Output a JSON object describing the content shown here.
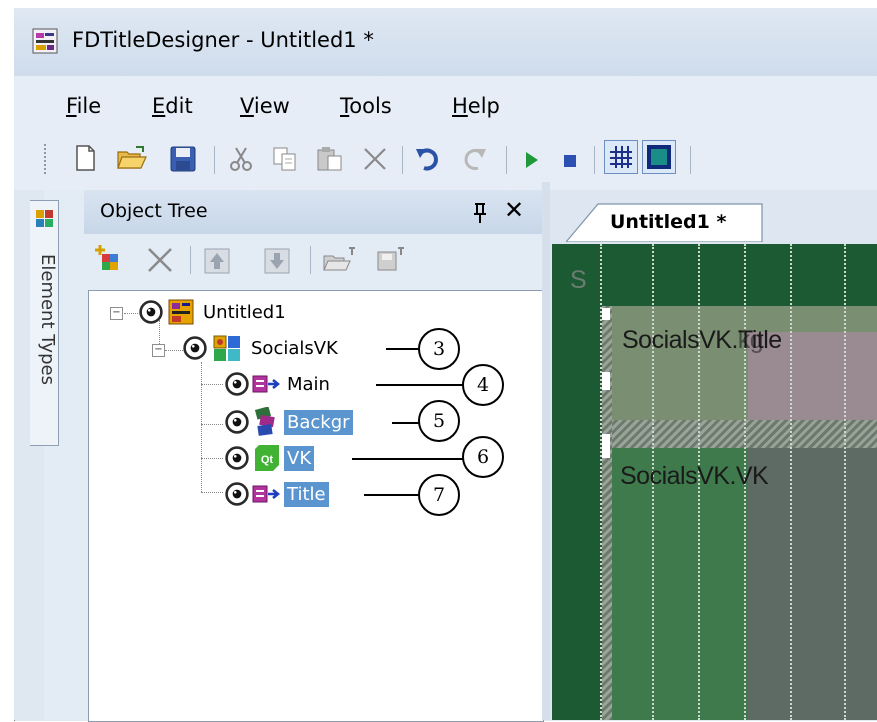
{
  "window": {
    "title": "FDTitleDesigner - Untitled1 *"
  },
  "menu": [
    {
      "first": "F",
      "rest": "ile"
    },
    {
      "first": "E",
      "rest": "dit"
    },
    {
      "first": "V",
      "rest": "iew"
    },
    {
      "first": "T",
      "rest": "ools"
    },
    {
      "first": "H",
      "rest": "elp"
    }
  ],
  "side_tab": {
    "label": "Element Types"
  },
  "panel": {
    "title": "Object Tree",
    "pin_glyph": "q",
    "close_glyph": "✕"
  },
  "tree": {
    "root": {
      "label": "Untitled1"
    },
    "group": {
      "label": "SocialsVK"
    },
    "items": [
      {
        "label": "Main",
        "selected": false
      },
      {
        "label": "Backgr",
        "selected": true
      },
      {
        "label": "VK",
        "selected": true
      },
      {
        "label": "Title",
        "selected": true
      }
    ]
  },
  "callouts": [
    "3",
    "4",
    "5",
    "6",
    "7"
  ],
  "document": {
    "tab_label": "Untitled1 *",
    "canvas_corner_label": "S",
    "canvas_title_text": "SocialsVK.Title",
    "canvas_title_overlap": "kg",
    "canvas_vk_text": "SocialsVK.VK"
  },
  "colors": {
    "selection": "#5b95d0",
    "canvas_green": "#1e5a36",
    "window_bg": "#e3ebf5"
  }
}
